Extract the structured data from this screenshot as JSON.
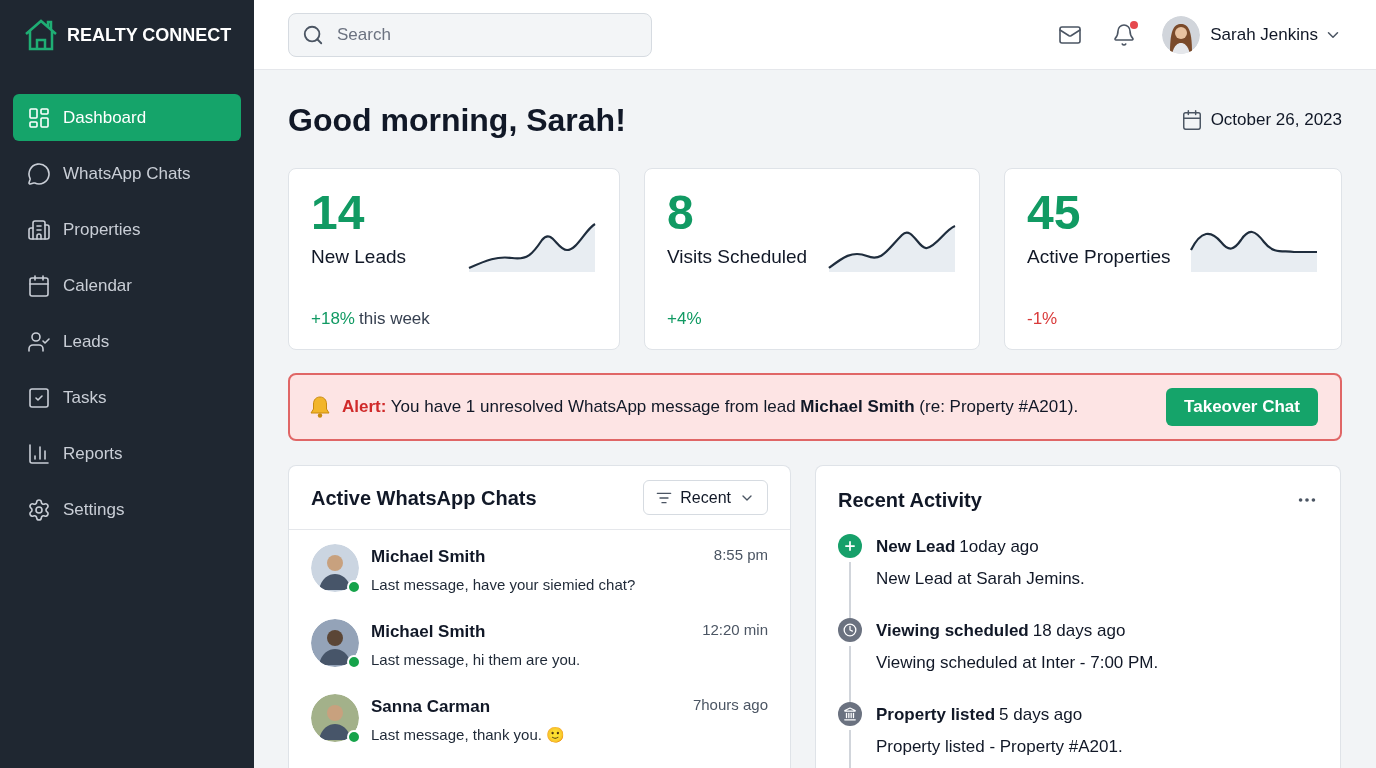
{
  "brand": {
    "name": "REALTY CONNECT"
  },
  "sidebar": {
    "items": [
      {
        "label": "Dashboard",
        "selected": true
      },
      {
        "label": "WhatsApp Chats",
        "selected": false
      },
      {
        "label": "Properties",
        "selected": false
      },
      {
        "label": "Calendar",
        "selected": false
      },
      {
        "label": "Leads",
        "selected": false
      },
      {
        "label": "Tasks",
        "selected": false
      },
      {
        "label": "Reports",
        "selected": false
      },
      {
        "label": "Settings",
        "selected": false
      }
    ]
  },
  "header": {
    "search": {
      "placeholder": "Search"
    },
    "notifications": {
      "unread": true
    },
    "user": {
      "name": "Sarah Jenkins"
    }
  },
  "greeting": "Good morning, Sarah!",
  "date": "October 26, 2023",
  "stats": [
    {
      "value": "14",
      "label": "New Leads",
      "change": "+18%",
      "change_suffix": "this week",
      "color": "#119a63"
    },
    {
      "value": "8",
      "label": "Visits Scheduled",
      "change": "+4%",
      "color": "#119a63"
    },
    {
      "value": "45",
      "label": "Active Properties",
      "change": "-1%",
      "color": "#d93a3a"
    }
  ],
  "alert": {
    "text": "**Alert:** You have 1 unresolved WhatsApp message from lead **Michael Smith** (re: Property #A201).",
    "button": "Takeover Chat"
  },
  "chats": {
    "title": "Active WhatsApp Chats",
    "filter": "Recent",
    "items": [
      {
        "name": "Michael Smith",
        "time": "8:55 pm",
        "message": "Last message, have your siemied chat?",
        "online": true
      },
      {
        "name": "Michael Smith",
        "time": "12:20 min",
        "message": "Last message, hi them are you.",
        "online": true
      },
      {
        "name": "Sanna Carman",
        "time": "7hours ago",
        "message": "Last message, thank you. 🙂",
        "online": true
      }
    ]
  },
  "activity": {
    "title": "Recent Activity",
    "items": [
      {
        "kind": "lead",
        "title": "New Lead",
        "time": "1oday ago",
        "description": "New Lead at Sarah Jemins.",
        "color": "#16a06a"
      },
      {
        "kind": "viewing",
        "title": "Viewing scheduled",
        "time": "18 days ago",
        "description": "Viewing scheduled at Inter - 7:00 PM.",
        "color": "#6b7280"
      },
      {
        "kind": "listing",
        "title": "Property listed",
        "time": "5 days ago",
        "description": "Property listed - Property #A201.",
        "color": "#6b7280"
      }
    ]
  }
}
